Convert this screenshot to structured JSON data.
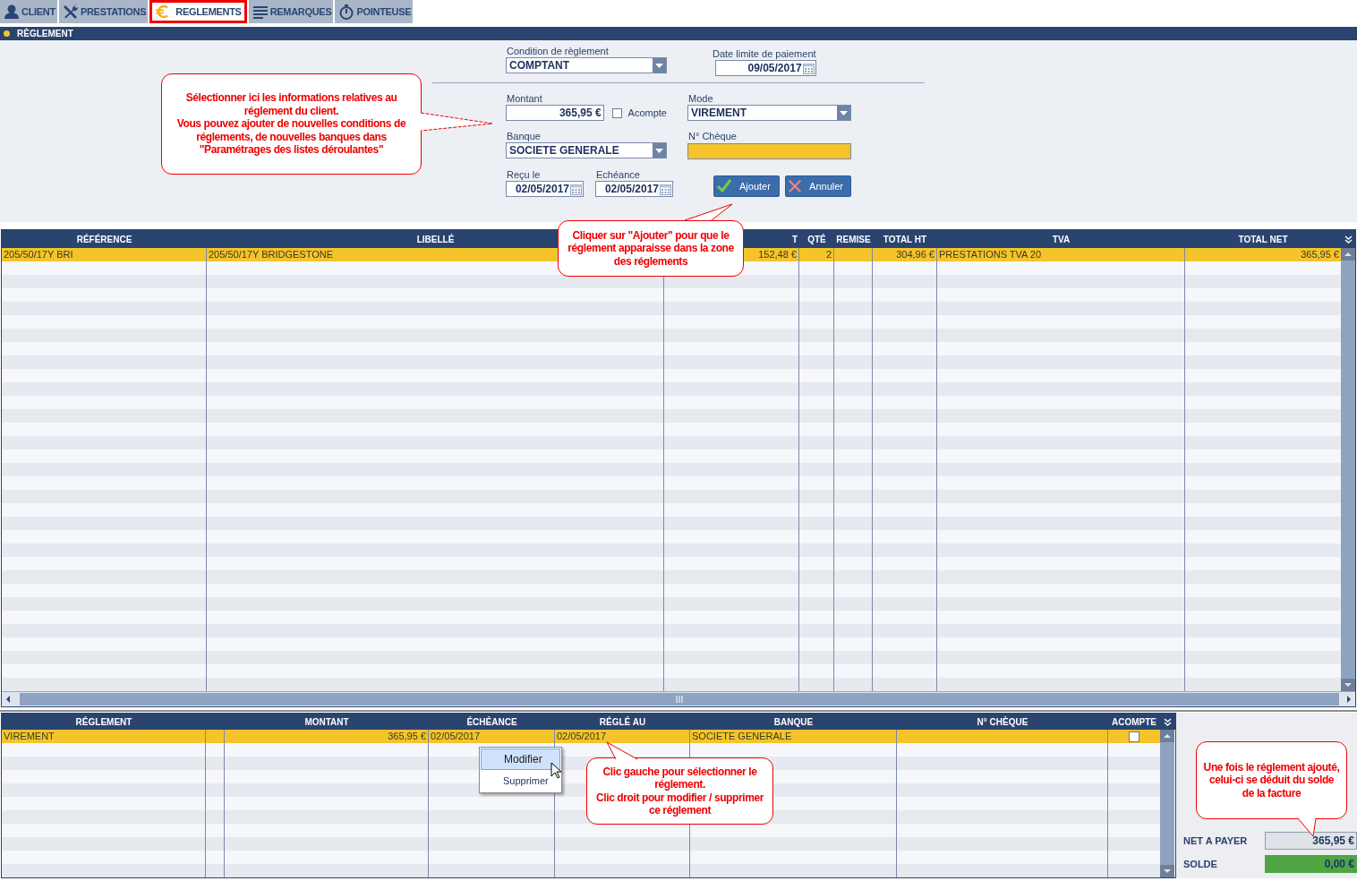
{
  "tabs": [
    {
      "label": "CLIENT",
      "selected": false
    },
    {
      "label": "PRESTATIONS",
      "selected": false
    },
    {
      "label": "REGLEMENTS",
      "selected": true
    },
    {
      "label": "REMARQUES",
      "selected": false
    },
    {
      "label": "POINTEUSE",
      "selected": false
    }
  ],
  "section_title": "RÈGLEMENT",
  "form": {
    "condition": {
      "label": "Condition de règlement",
      "value": "COMPTANT"
    },
    "date_limite": {
      "label": "Date limite de paiement",
      "value": "09/05/2017"
    },
    "montant": {
      "label": "Montant",
      "value": "365,95 €"
    },
    "acompte": {
      "label": "Acompte",
      "checked": false
    },
    "mode": {
      "label": "Mode",
      "value": "VIREMENT"
    },
    "banque": {
      "label": "Banque",
      "value": "SOCIETE GENERALE"
    },
    "cheque": {
      "label": "N° Chèque"
    },
    "recu_le": {
      "label": "Reçu le",
      "value": "02/05/2017"
    },
    "echeance": {
      "label": "Echéance",
      "value": "02/05/2017"
    },
    "buttons": [
      "Ajouter",
      "Annuler"
    ]
  },
  "items_table": {
    "columns": [
      "RÉFÉRENCE",
      "LIBELLÉ",
      "T",
      "QTÉ",
      "REMISE",
      "TOTAL HT",
      "TVA",
      "TOTAL NET"
    ],
    "rows": [
      {
        "cells": [
          "205/50/17Y BRI",
          "205/50/17Y BRIDGESTONE",
          "152,48 €",
          "2",
          null,
          "304,96 €",
          "PRESTATIONS TVA 20",
          "365,95 €"
        ],
        "selected": true
      }
    ]
  },
  "payments_table": {
    "columns": [
      "RÉGLEMENT",
      null,
      "MONTANT",
      "ÉCHÉANCE",
      "RÉGLÉ AU",
      "BANQUE",
      "N° CHÈQUE",
      "ACOMPTE"
    ],
    "rows": [
      {
        "cells": [
          "VIREMENT",
          null,
          "365,95 €",
          "02/05/2017",
          "02/05/2017",
          "SOCIETE GENERALE",
          null
        ],
        "acompte_checked": false,
        "selected": true
      }
    ]
  },
  "context_menu": [
    {
      "label": "Modifier",
      "selected": true
    },
    {
      "label": "Supprimer",
      "selected": false
    }
  ],
  "totals": {
    "net_a_payer": {
      "label": "NET A PAYER",
      "value": "365,95 €"
    },
    "solde": {
      "label": "SOLDE",
      "value": "0,00 €"
    }
  },
  "callouts": [
    "Sélectionner ici les informations relatives au réglement du client.\nVous pouvez ajouter de nouvelles conditions de réglements, de nouvelles banques dans \"Paramétrages des listes déroulantes\"",
    "Cliquer sur \"Ajouter\" pour que le réglement apparaisse dans la zone des réglements",
    "Clic gauche pour sélectionner le réglement.\nClic droit pour modifier / supprimer ce réglement",
    "Une fois le réglement ajouté, celui-ci se déduit du solde de la facture"
  ]
}
